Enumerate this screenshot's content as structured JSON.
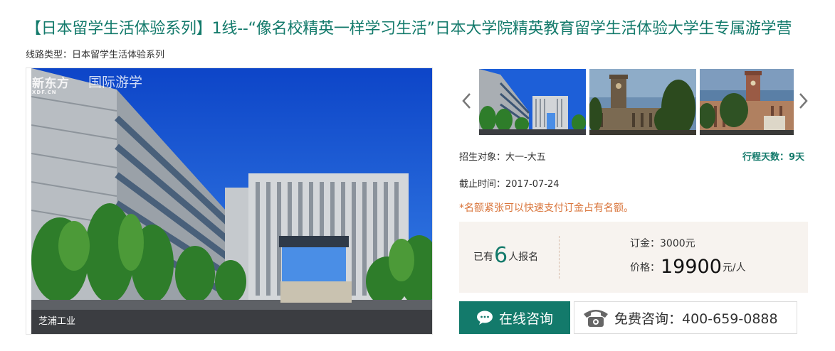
{
  "header": {
    "title": "【日本留学生活体验系列】1线--“像名校精英一样学习生活”日本大学院精英教育留学生活体验大学生专属游学营",
    "route_type": "线路类型：日本留学生活体验系列"
  },
  "gallery": {
    "main_caption": "芝浦工业",
    "logo_text": "新东方",
    "logo_sub": "XDF.CN",
    "logo_text2": "国际游学",
    "thumbnails": [
      "campus-building",
      "clock-tower-hall",
      "red-brick-tower"
    ]
  },
  "info": {
    "recruit": "招生对象：大一-大五",
    "days": "行程天数：9天",
    "deadline": "截止时间：2017-07-24",
    "notice": "*名额紧张可以快速支付订金占有名额。"
  },
  "pricing": {
    "booked_prefix": "已有",
    "booked_count": "6",
    "booked_suffix": "人报名",
    "deposit": "订金：3000元",
    "price_prefix": "价格：",
    "price_amount": "19900",
    "price_suffix": "元/人"
  },
  "actions": {
    "consult_label": "在线咨询",
    "phone_label": "免费咨询：400-659-0888"
  },
  "colors": {
    "accent": "#137a6b",
    "notice": "#d9743a",
    "price_bg": "#f7f3ef"
  }
}
